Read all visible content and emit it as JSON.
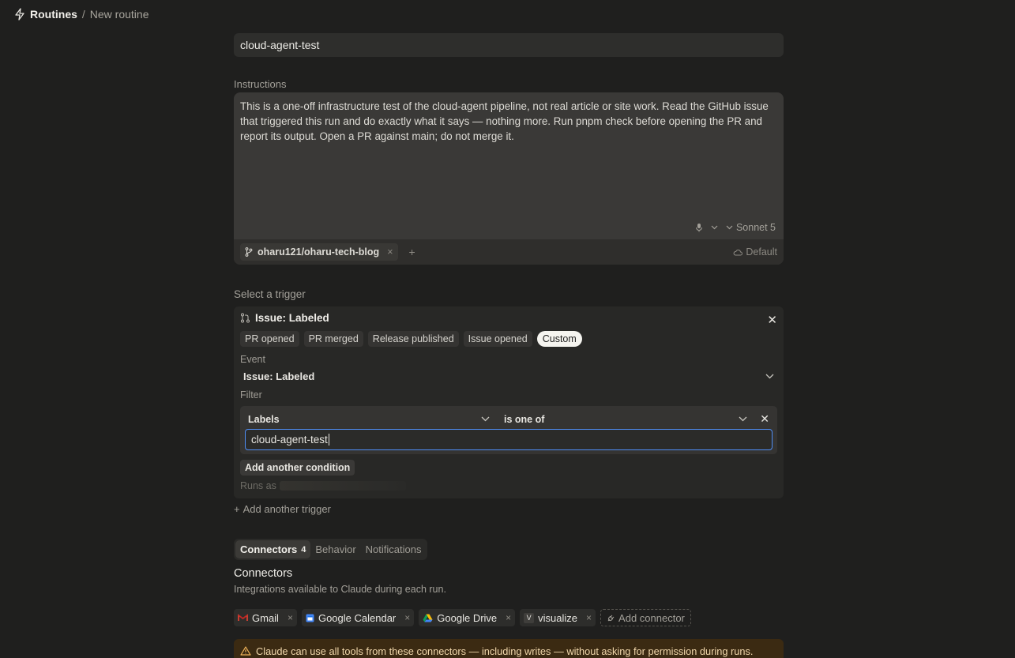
{
  "breadcrumb": {
    "root": "Routines",
    "separator": "/",
    "current": "New routine"
  },
  "routine_name": "cloud-agent-test",
  "instructions": {
    "label": "Instructions",
    "text": "This is a one-off infrastructure test of the cloud-agent pipeline, not real article or site work. Read the GitHub issue that triggered this run and do exactly what it says — nothing more. Run pnpm check before opening the PR and report its output. Open a PR against main; do not merge it.",
    "model": "Sonnet 5",
    "repo": "oharu121/oharu-tech-blog",
    "environment": "Default"
  },
  "trigger": {
    "section_label": "Select a trigger",
    "title": "Issue: Labeled",
    "presets": [
      "PR opened",
      "PR merged",
      "Release published",
      "Issue opened",
      "Custom"
    ],
    "active_preset": "Custom",
    "event_label": "Event",
    "event_value": "Issue: Labeled",
    "filter_label": "Filter",
    "filter_field": "Labels",
    "filter_operator": "is one of",
    "filter_value": "cloud-agent-test",
    "add_condition": "Add another condition",
    "runs_as_label": "Runs as"
  },
  "add_trigger": "Add another trigger",
  "tabs": [
    {
      "label": "Connectors",
      "count": "4"
    },
    {
      "label": "Behavior"
    },
    {
      "label": "Notifications"
    }
  ],
  "connectors": {
    "title": "Connectors",
    "description": "Integrations available to Claude during each run.",
    "items": [
      {
        "name": "Gmail",
        "icon": "gmail-icon"
      },
      {
        "name": "Google Calendar",
        "icon": "google-calendar-icon"
      },
      {
        "name": "Google Drive",
        "icon": "google-drive-icon"
      },
      {
        "name": "visualize",
        "icon": "visualize-icon"
      }
    ],
    "add_label": "Add connector",
    "warning": "Claude can use all tools from these connectors — including writes — without asking for permission during runs."
  },
  "colors": {
    "accent_focus": "#4f8ef5",
    "warning_bg": "#3b2a12",
    "background": "#1f1f1e"
  }
}
